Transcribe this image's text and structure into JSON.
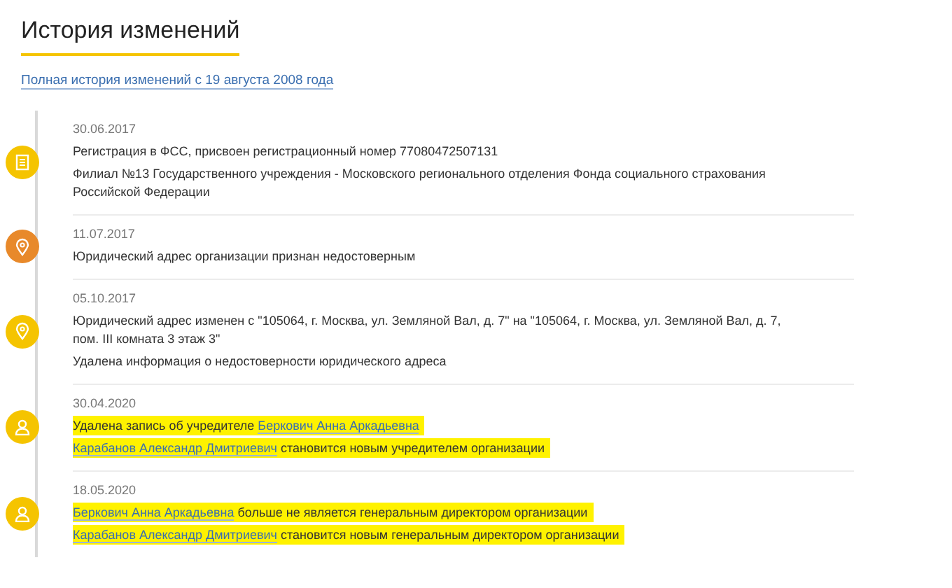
{
  "title": "История изменений",
  "history_link": "Полная история изменений с 19 августа 2008 года",
  "events": [
    {
      "date": "30.06.2017",
      "kind": "document",
      "color": "#f5c400",
      "lines": [
        {
          "highlighted": false,
          "parts": [
            {
              "text": "Регистрация в ФСС, присвоен регистрационный номер 77080472507131",
              "link": false
            }
          ]
        },
        {
          "highlighted": false,
          "parts": [
            {
              "text": "Филиал №13 Государственного учреждения - Московского регионального отделения Фонда социального страхования Российской Федерации",
              "link": false
            }
          ]
        }
      ]
    },
    {
      "date": "11.07.2017",
      "kind": "pin",
      "color": "#e8892a",
      "lines": [
        {
          "highlighted": false,
          "parts": [
            {
              "text": "Юридический адрес организации признан недостоверным",
              "link": false
            }
          ]
        }
      ]
    },
    {
      "date": "05.10.2017",
      "kind": "pin",
      "color": "#f5c400",
      "lines": [
        {
          "highlighted": false,
          "parts": [
            {
              "text": "Юридический адрес изменен с \"105064, г. Москва, ул. Земляной Вал, д. 7\" на \"105064, г. Москва, ул. Земляной Вал, д. 7, пом. III комната 3 этаж 3\"",
              "link": false
            }
          ]
        },
        {
          "highlighted": false,
          "parts": [
            {
              "text": "Удалена информация о недостоверности юридического адреса",
              "link": false
            }
          ]
        }
      ]
    },
    {
      "date": "30.04.2020",
      "kind": "person",
      "color": "#f5c400",
      "lines": [
        {
          "highlighted": true,
          "parts": [
            {
              "text": "Удалена запись об учредителе",
              "link": false
            },
            {
              "text": "Беркович Анна Аркадьевна",
              "link": true
            }
          ]
        },
        {
          "highlighted": true,
          "parts": [
            {
              "text": "Карабанов Александр Дмитриевич",
              "link": true
            },
            {
              "text": "становится новым учредителем организации",
              "link": false
            }
          ]
        }
      ]
    },
    {
      "date": "18.05.2020",
      "kind": "person",
      "color": "#f5c400",
      "lines": [
        {
          "highlighted": true,
          "parts": [
            {
              "text": "Беркович Анна Аркадьевна",
              "link": true
            },
            {
              "text": "больше не является генеральным директором организации",
              "link": false
            }
          ]
        },
        {
          "highlighted": true,
          "parts": [
            {
              "text": "Карабанов Александр Дмитриевич",
              "link": true
            },
            {
              "text": "становится новым генеральным директором организации",
              "link": false
            }
          ]
        }
      ]
    }
  ]
}
